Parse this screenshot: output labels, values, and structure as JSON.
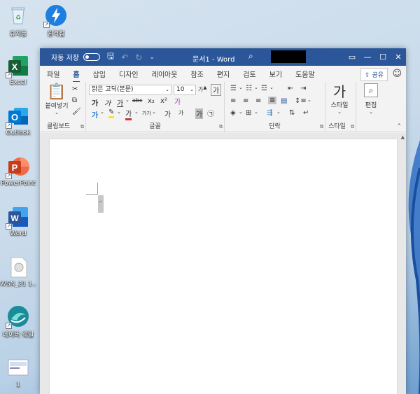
{
  "desktop": {
    "icons": [
      {
        "label": "휴지통"
      },
      {
        "label": "원격접"
      },
      {
        "label": "Excel"
      },
      {
        "label": "Outlook"
      },
      {
        "label": "PowerPoint"
      },
      {
        "label": "Word"
      },
      {
        "label": "WSN_21 1..."
      },
      {
        "label": "네이버 웨일"
      },
      {
        "label": "1"
      }
    ]
  },
  "titlebar": {
    "autosave_label": "자동 저장",
    "autosave_state": "off",
    "doc_title": "문서1 - Word"
  },
  "tabs": [
    "파일",
    "홈",
    "삽입",
    "디자인",
    "레이아웃",
    "참조",
    "편지",
    "검토",
    "보기",
    "도움말"
  ],
  "active_tab": "홈",
  "share_label": "공유",
  "ribbon": {
    "clipboard": {
      "paste_label": "붙여넣기",
      "group_label": "클립보드"
    },
    "font": {
      "font_name": "맑은 고딕(본문)",
      "font_size": "10",
      "bold": "가",
      "italic": "가",
      "underline": "가",
      "strike": "abc",
      "subscript": "x₂",
      "superscript": "x²",
      "grow": "가",
      "shrink": "가",
      "case": "가가",
      "clear": "가",
      "font_color": "가",
      "char_border": "가",
      "group_label": "글꼴"
    },
    "paragraph": {
      "group_label": "단락"
    },
    "styles": {
      "big_glyph": "가",
      "style_label": "스타일",
      "group_label": "스타일"
    },
    "editing": {
      "edit_label": "편집"
    }
  },
  "colors": {
    "title_bar": "#2b579a",
    "accent": "#2b579a",
    "highlight": "#f5e33a",
    "font_color_red": "#d13438"
  }
}
